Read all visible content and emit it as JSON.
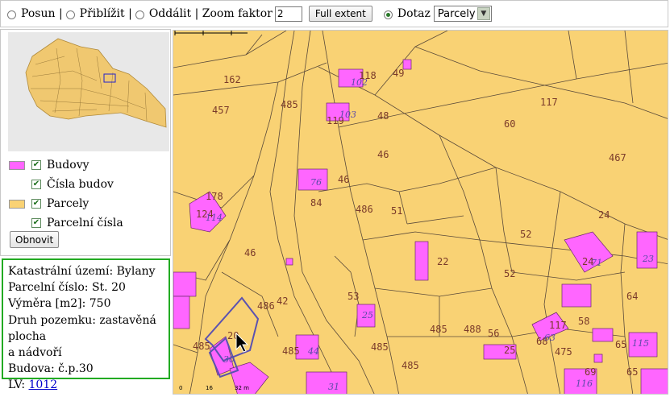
{
  "toolbar": {
    "pan_label": "Posun |",
    "zoom_in_label": "Přiblížit |",
    "zoom_out_label": "Oddálit | Zoom faktor",
    "zoom_factor": "2",
    "full_extent_label": "Full extent",
    "query_label": "Dotaz",
    "query_layer": "Parcely",
    "selected_tool": "query"
  },
  "legend": {
    "items": [
      {
        "label": "Budovy",
        "color": "#ff66ff",
        "checked": true
      },
      {
        "label": "Čísla budov",
        "checked": true
      },
      {
        "label": "Parcely",
        "color": "#f9d274",
        "checked": true
      },
      {
        "label": "Parcelní čísla",
        "checked": true
      }
    ],
    "refresh_label": "Obnovit"
  },
  "info": {
    "cadastral_area": "Katastrální území: Bylany",
    "parcel_number": "Parcelní číslo: St. 20",
    "area": "Výměra [m2]: 750",
    "land_type_line1": "Druh pozemku: zastavěná plocha",
    "land_type_line2": "a nádvoří",
    "building": "Budova: č.p.30",
    "lv_prefix": "LV: ",
    "lv_link": "1012"
  },
  "map": {
    "parcel_color": "#f9d274",
    "building_color": "#ff66ff",
    "parcel_labels": [
      "162",
      "457",
      "485",
      "118",
      "49",
      "48",
      "119",
      "117",
      "60",
      "46",
      "467",
      "178",
      "124",
      "46",
      "84",
      "486",
      "51",
      "24",
      "52",
      "46",
      "22",
      "24",
      "52",
      "64",
      "53",
      "486",
      "42",
      "485",
      "488",
      "56",
      "117",
      "58",
      "485",
      "485",
      "25",
      "68",
      "475",
      "65",
      "485",
      "69",
      "65",
      "20"
    ],
    "building_labels": [
      "102",
      "103",
      "76",
      "114",
      "25",
      "44",
      "30",
      "31",
      "63",
      "71",
      "23",
      "115",
      "116"
    ],
    "scale_labels": [
      "0",
      "16",
      "32 m"
    ]
  }
}
